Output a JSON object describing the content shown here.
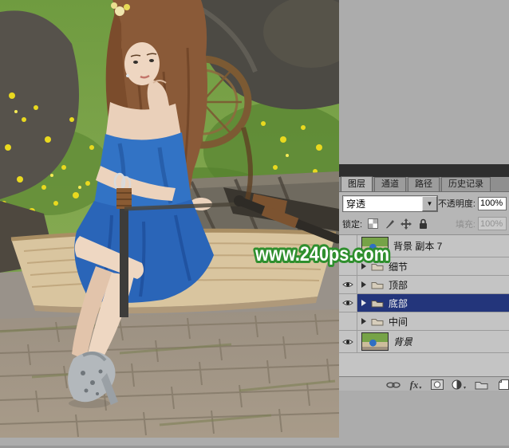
{
  "canvas": {
    "watermark": "www.240ps.com"
  },
  "layers_panel": {
    "tabs": [
      {
        "label": "图层",
        "active": true
      },
      {
        "label": "通道",
        "active": false
      },
      {
        "label": "路径",
        "active": false
      },
      {
        "label": "历史记录",
        "active": false
      }
    ],
    "blend_mode": {
      "value": "穿透"
    },
    "opacity": {
      "label": "不透明度:",
      "value": "100%"
    },
    "lock": {
      "label": "锁定:",
      "icons": [
        "lock-transparency-icon",
        "lock-pixels-icon",
        "lock-position-icon",
        "lock-all-icon"
      ]
    },
    "fill": {
      "label": "填充:",
      "value": "100%",
      "disabled": true
    },
    "layers": [
      {
        "name": "背景 副本 7",
        "type": "image",
        "visible": false,
        "selected": false
      },
      {
        "name": "细节",
        "type": "group",
        "visible": false,
        "selected": false
      },
      {
        "name": "顶部",
        "type": "group",
        "visible": true,
        "selected": false
      },
      {
        "name": "底部",
        "type": "group",
        "visible": true,
        "selected": true
      },
      {
        "name": "中间",
        "type": "group",
        "visible": false,
        "selected": false
      },
      {
        "name": "背景",
        "type": "image",
        "visible": true,
        "selected": false
      }
    ],
    "footer_icons": [
      "link-layers-icon",
      "layer-style-fx-icon",
      "add-layer-mask-icon",
      "new-adjustment-layer-icon",
      "new-group-icon",
      "new-layer-icon"
    ]
  }
}
